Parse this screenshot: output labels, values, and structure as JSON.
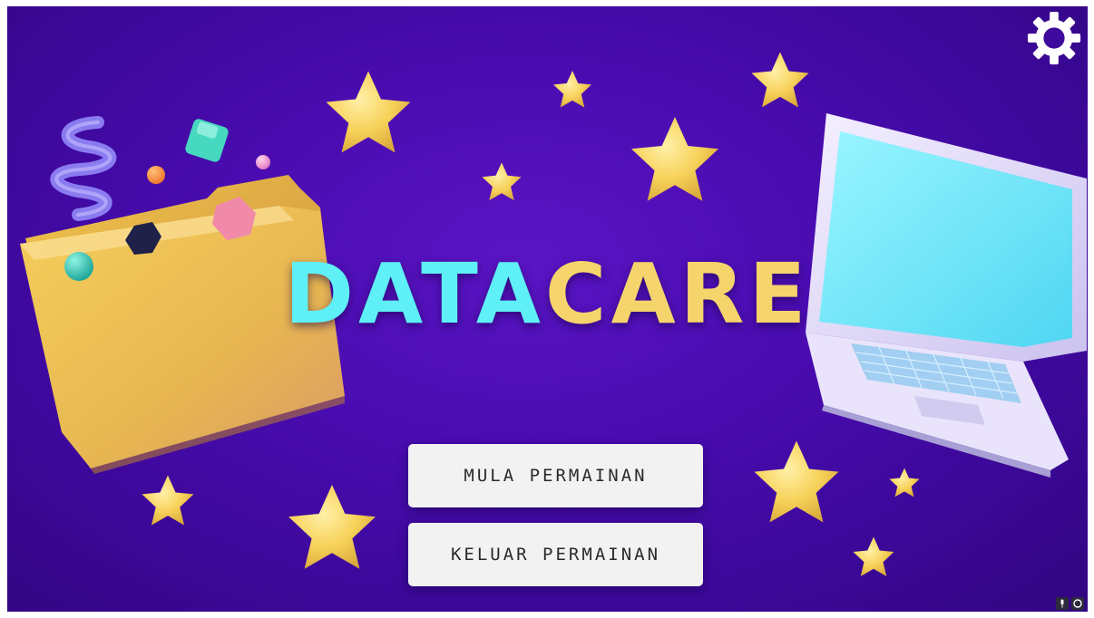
{
  "game": {
    "logo_part1": "DATA",
    "logo_part2": "CARE"
  },
  "menu": {
    "start_label": "MULA PERMAINAN",
    "exit_label": "KELUAR PERMAINAN"
  },
  "icons": {
    "settings": "gear-icon",
    "microphone": "microphone-icon",
    "loading": "circle-icon"
  },
  "colors": {
    "background": "#4a0cb0",
    "logo_cyan": "#5ef0f6",
    "logo_yellow": "#f5d46c",
    "button_bg": "#f2f2f2",
    "star": "#f7d25a"
  }
}
